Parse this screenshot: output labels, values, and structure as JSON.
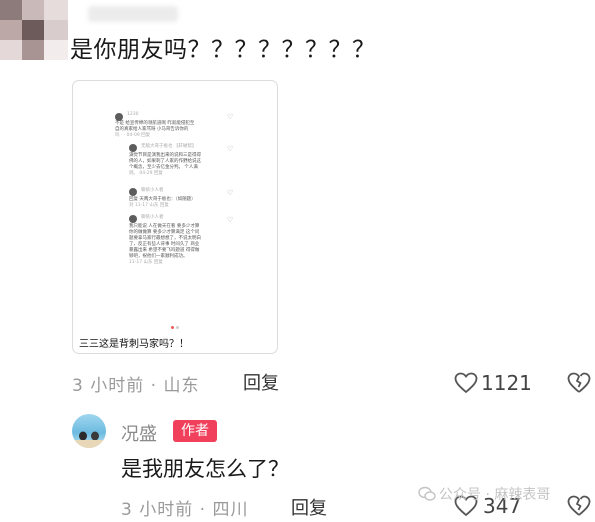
{
  "comment1": {
    "text": "是你朋友吗？？？？？？？？",
    "image": {
      "caption": "三三这是背刺马家吗？！",
      "thread": {
        "user1": "1230",
        "line1": "不是 给宣传棉的领航道啊 咋就能侵犯至",
        "line2": "自的真家给人家骂呀 小马哥告诉你的",
        "line3": "吗 · · 04-09 回复",
        "user2": "无敌大哥于板也 【轩磁帮】",
        "line4": "满觉节目是演我出来的说和三是得得",
        "line5": "佛的人，如果刺了人家的作野给说这",
        "line6": "个概念，至少去亿金分判。 个人满",
        "line7": "则。 04-29 回复",
        "user3": "聊侬小人者",
        "line8": "回复 天两大哥于板也：（如随题）",
        "line9": "对 11-17 山东 回复",
        "user4": "聊侬小人者",
        "line10": "我只能说 人在做天在看 要多少才算",
        "line11": "你的做做算 要多少才算满足 这个问",
        "line12": "题要拿马家行最想想了，不说太明白",
        "line13": "了，反正有些人背事 时间久了 商业",
        "line14": "暴露出来 希望不要飞吗题道 得得做",
        "line15": "够吧，祝他们一家顺利成功。",
        "line16": "11-17 山东 回复"
      }
    },
    "time": "3 小时前",
    "location": "山东",
    "reply_label": "回复",
    "like_count": "1121"
  },
  "comment2": {
    "author_name": "况盛",
    "author_tag": "作者",
    "text": "是我朋友怎么了？",
    "time": "3 小时前",
    "location": "四川",
    "reply_label": "回复",
    "like_count": "347"
  },
  "watermark": "公众号 · 麻辣表哥",
  "colors": {
    "author_tag": "#f0405b",
    "meta_gray": "#9a9a9a"
  },
  "icons": [
    "heart-icon",
    "broken-heart-icon",
    "wechat-icon"
  ]
}
